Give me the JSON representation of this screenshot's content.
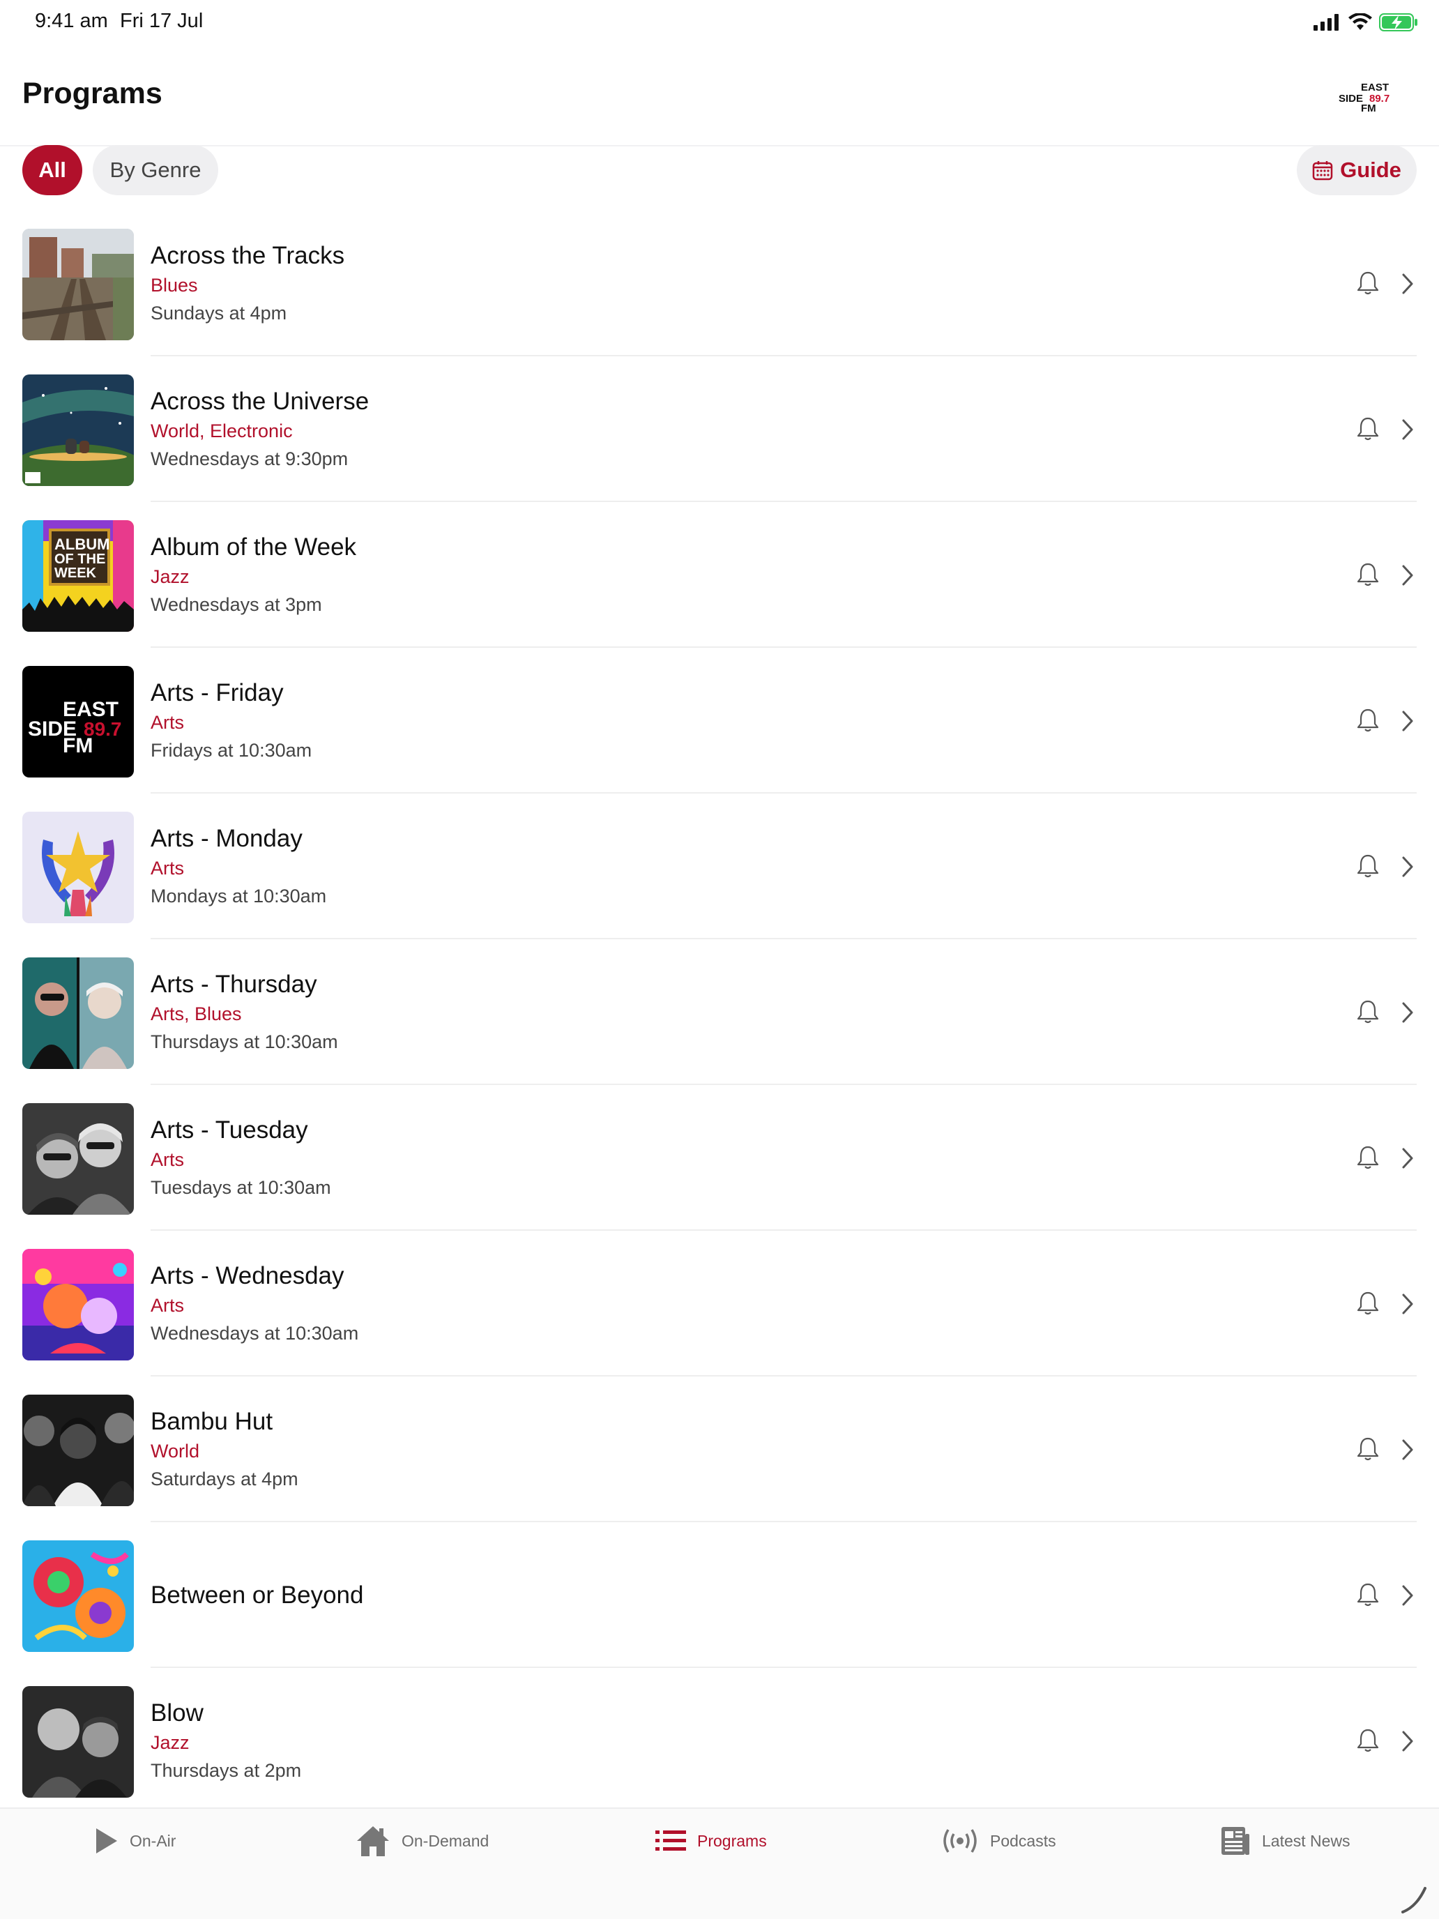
{
  "status_bar": {
    "time": "9:41 am",
    "date": "Fri 17 Jul"
  },
  "header": {
    "title": "Programs",
    "logo_text": [
      "EAST",
      "SIDE",
      "89.7",
      "FM"
    ]
  },
  "filters": {
    "all_label": "All",
    "genre_label": "By Genre",
    "guide_label": "Guide"
  },
  "colors": {
    "accent": "#b1102b",
    "pill_bg": "#efeff1",
    "text_secondary": "#444444"
  },
  "programs": [
    {
      "title": "Across the Tracks",
      "genre": "Blues",
      "schedule": "Sundays at 4pm",
      "thumb": "railway-tracks"
    },
    {
      "title": "Across the Universe",
      "genre": "World, Electronic",
      "schedule": "Wednesdays at 9:30pm",
      "thumb": "starry-sky"
    },
    {
      "title": "Album of the Week",
      "genre": "Jazz",
      "schedule": "Wednesdays at 3pm",
      "thumb": "album-of-the-week"
    },
    {
      "title": "Arts - Friday",
      "genre": "Arts",
      "schedule": "Fridays at 10:30am",
      "thumb": "eastside-logo"
    },
    {
      "title": "Arts - Monday",
      "genre": "Arts",
      "schedule": "Mondays at 10:30am",
      "thumb": "hands-star"
    },
    {
      "title": "Arts - Thursday",
      "genre": "Arts, Blues",
      "schedule": "Thursdays at 10:30am",
      "thumb": "two-presenters"
    },
    {
      "title": "Arts - Tuesday",
      "genre": "Arts",
      "schedule": "Tuesdays at 10:30am",
      "thumb": "two-presenters-bw"
    },
    {
      "title": "Arts - Wednesday",
      "genre": "Arts",
      "schedule": "Wednesdays at 10:30am",
      "thumb": "colourful-portrait"
    },
    {
      "title": "Bambu Hut",
      "genre": "World",
      "schedule": "Saturdays at 4pm",
      "thumb": "group-bw"
    },
    {
      "title": "Between or Beyond",
      "genre": "",
      "schedule": "",
      "thumb": "psychedelic-art"
    },
    {
      "title": "Blow",
      "genre": "Jazz",
      "schedule": "Thursdays at 2pm",
      "thumb": "two-men-bw"
    }
  ],
  "tabs": [
    {
      "label": "On-Air",
      "icon": "play-icon",
      "active": false
    },
    {
      "label": "On-Demand",
      "icon": "home-icon",
      "active": false
    },
    {
      "label": "Programs",
      "icon": "list-icon",
      "active": true
    },
    {
      "label": "Podcasts",
      "icon": "broadcast-icon",
      "active": false
    },
    {
      "label": "Latest News",
      "icon": "newspaper-icon",
      "active": false
    }
  ]
}
